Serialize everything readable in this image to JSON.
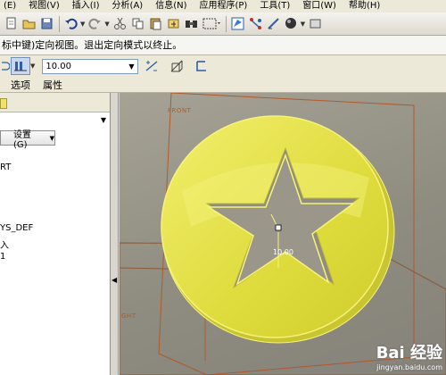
{
  "menubar": {
    "items": [
      "(E)",
      "视图(V)",
      "插入(I)",
      "分析(A)",
      "信息(N)",
      "应用程序(P)",
      "工具(T)",
      "窗口(W)",
      "帮助(H)"
    ]
  },
  "toolbar": {
    "icons": [
      "new-doc-icon",
      "open-icon",
      "save-icon",
      "undo-icon",
      "redo-icon",
      "cut-icon",
      "copy-icon",
      "paste-icon",
      "regenerate-icon",
      "find-icon",
      "select-box-icon",
      "datum-plane-icon",
      "axis-icon",
      "sketch-icon",
      "shading-icon"
    ]
  },
  "statusbar": {
    "text": "标中键)定向视图。退出定向模式以终止。"
  },
  "dashboard": {
    "depth_value": "10.00",
    "colors": {
      "active": "#c9d8ee",
      "border": "#6f8fb5"
    }
  },
  "dashboard_tabs": {
    "options": "选项",
    "properties": "属性"
  },
  "left_panel": {
    "settings_label": "设置 (G)",
    "tree": [
      "RT",
      "YS_DEF",
      "入",
      "1"
    ]
  },
  "viewport": {
    "front_label": "FRONT",
    "right_label": "GHT",
    "dimension": "10.00",
    "watermark_main": "Bai 经验",
    "watermark_sub": "jingyan.baidu.com",
    "colors": {
      "model_fill": "#e4e03a",
      "model_edge": "#f6f37a",
      "plane": "#b05a2a",
      "background": "#9a978a"
    }
  }
}
